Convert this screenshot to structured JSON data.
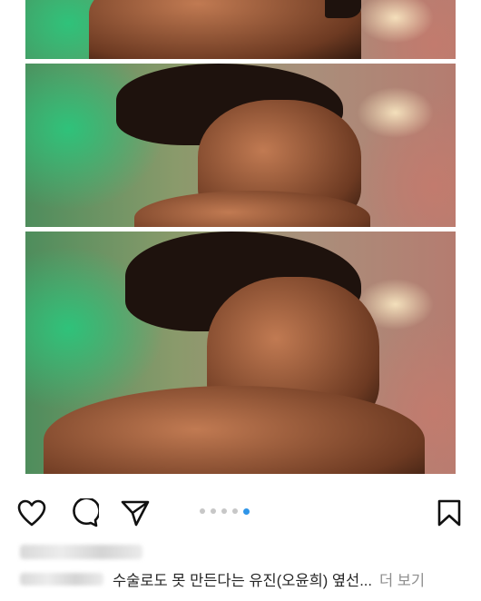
{
  "post": {
    "carousel": {
      "total_slides": 5,
      "active_index": 4
    },
    "actions": {
      "like_icon": "heart-outline-icon",
      "comment_icon": "comment-bubble-icon",
      "share_icon": "paper-plane-icon",
      "save_icon": "bookmark-outline-icon"
    },
    "caption": {
      "text": "수술로도 못 만든다는 유진(오윤희) 옆선...",
      "more_label": "더 보기"
    }
  },
  "colors": {
    "active_dot": "#2f95e8",
    "inactive_dot": "#c7c7c7",
    "icon_stroke": "#111111",
    "more_link": "#8e8e8e"
  }
}
